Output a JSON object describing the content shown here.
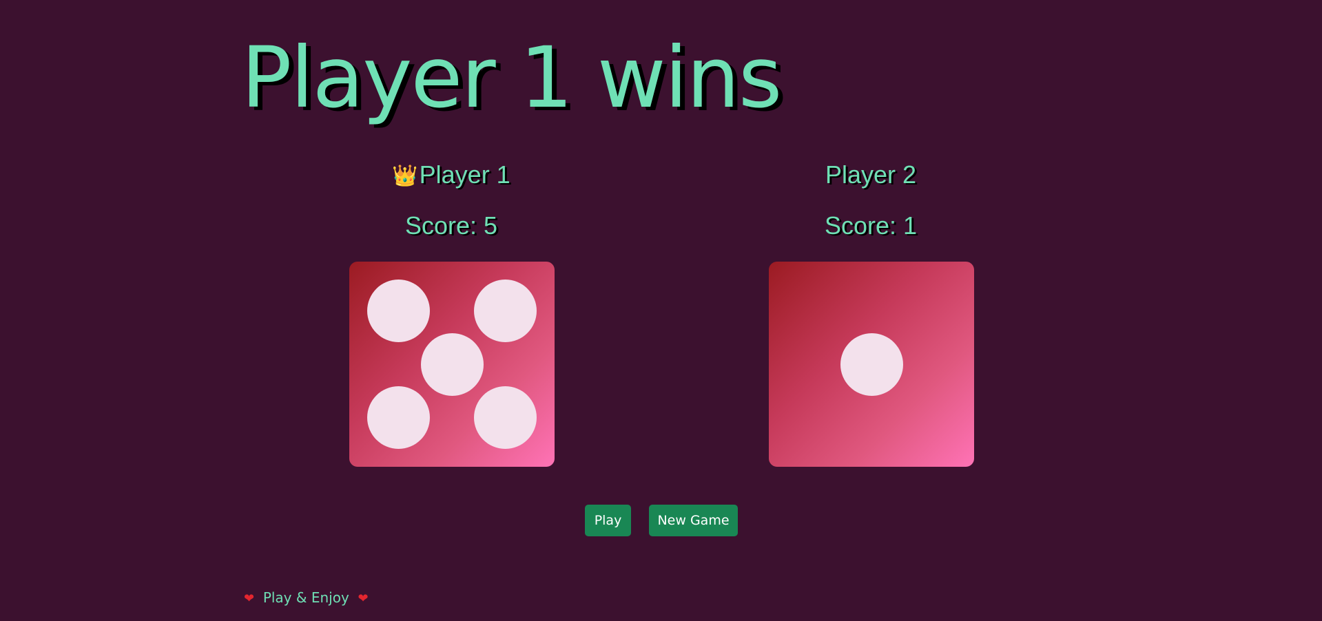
{
  "title": "Player 1 wins",
  "players": [
    {
      "name": "Player 1",
      "score_text": "Score: 5",
      "winner_icon": "👑",
      "die_value": 5
    },
    {
      "name": "Player 2",
      "score_text": "Score: 1",
      "die_value": 1
    }
  ],
  "buttons": {
    "play_label": "Play",
    "new_game_label": "New Game"
  },
  "footer": {
    "left_heart": "❤",
    "text": "Play & Enjoy",
    "right_heart": "❤"
  },
  "colors": {
    "background": "#3c112f",
    "text_accent": "#6fe0b5",
    "button": "#198754",
    "pip": "#f3e1ec",
    "die_gradient_start": "#9b1b22",
    "die_gradient_end": "#ff73b6"
  }
}
